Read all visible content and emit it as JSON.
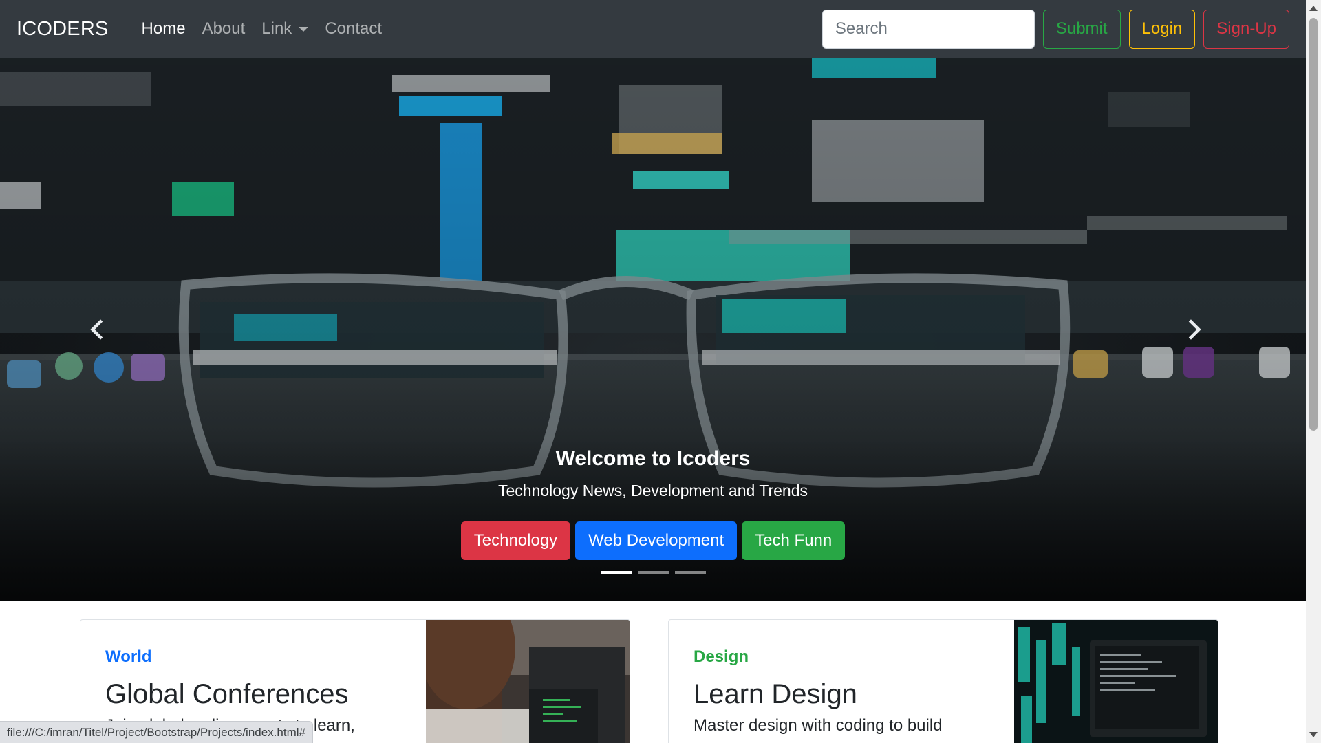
{
  "navbar": {
    "brand": "ICODERS",
    "links": [
      {
        "label": "Home",
        "active": true
      },
      {
        "label": "About"
      },
      {
        "label": "Link",
        "dropdown": true
      },
      {
        "label": "Contact"
      }
    ],
    "search_placeholder": "Search",
    "buttons": {
      "submit": {
        "label": "Submit",
        "color": "#28a745"
      },
      "login": {
        "label": "Login",
        "color": "#ffc107"
      },
      "signup": {
        "label": "Sign-Up",
        "color": "#dc3545"
      }
    }
  },
  "carousel": {
    "title": "Welcome to Icoders",
    "subtitle": "Technology News, Development and Trends",
    "buttons": [
      {
        "label": "Technology",
        "color": "#dc3545"
      },
      {
        "label": "Web Development",
        "color": "#0d6efd"
      },
      {
        "label": "Tech Funn",
        "color": "#28a745"
      }
    ],
    "prev_icon": "chevron-left-icon",
    "next_icon": "chevron-right-icon",
    "slide_count": 3,
    "active_slide": 0
  },
  "cards": [
    {
      "category": "World",
      "category_color": "#0d6efd",
      "title": "Global Conferences",
      "text": "Join global coding events to learn,"
    },
    {
      "category": "Design",
      "category_color": "#28a745",
      "title": "Learn Design",
      "text": "Master design with coding to build"
    }
  ],
  "status_bar": {
    "url": "file:///C:/imran/Titel/Project/Bootstrap/Projects/index.html#"
  }
}
